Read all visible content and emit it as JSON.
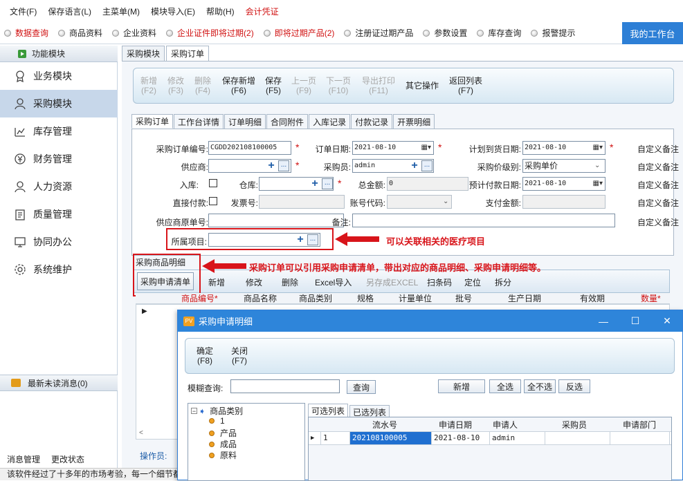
{
  "menu": [
    "文件(F)",
    "保存语言(L)",
    "主菜单(M)",
    "模块导入(E)",
    "帮助(H)",
    "会计凭证"
  ],
  "quickbar": {
    "items": [
      {
        "label": "数据查询",
        "red": true
      },
      {
        "label": "商品资料",
        "red": false
      },
      {
        "label": "企业资料",
        "red": false
      },
      {
        "label": "企业证件即将过期(2)",
        "red": true
      },
      {
        "label": "即将过期产品(2)",
        "red": true
      },
      {
        "label": "注册证过期产品",
        "red": false
      },
      {
        "label": "参数设置",
        "red": false
      },
      {
        "label": "库存查询",
        "red": false
      },
      {
        "label": "报警提示",
        "red": false
      }
    ],
    "workbench": "我的工作台"
  },
  "left": {
    "header": "功能模块",
    "modules": [
      "业务模块",
      "采购模块",
      "库存管理",
      "财务管理",
      "人力资源",
      "质量管理",
      "协同办公",
      "系统维护"
    ],
    "selected_index": 1,
    "unread": "最新未读消息(0)",
    "bottom_links": [
      "消息管理",
      "更改状态"
    ]
  },
  "main_tabs": [
    "采购模块",
    "采购订单"
  ],
  "toolbar": [
    {
      "label": "新增",
      "key": "(F2)",
      "enabled": false
    },
    {
      "label": "修改",
      "key": "(F3)",
      "enabled": false
    },
    {
      "label": "删除",
      "key": "(F4)",
      "enabled": false
    },
    {
      "label": "保存新增",
      "key": "(F6)",
      "enabled": true
    },
    {
      "label": "保存",
      "key": "(F5)",
      "enabled": true
    },
    {
      "label": "上一页",
      "key": "(F9)",
      "enabled": false
    },
    {
      "label": "下一页",
      "key": "(F10)",
      "enabled": false
    },
    {
      "label": "导出打印",
      "key": "(F11)",
      "enabled": false
    },
    {
      "label": "其它操作",
      "key": "",
      "enabled": true
    },
    {
      "label": "返回列表",
      "key": "(F7)",
      "enabled": true
    }
  ],
  "form_tabs": [
    "采购订单",
    "工作台详情",
    "订单明细",
    "合同附件",
    "入库记录",
    "付款记录",
    "开票明细"
  ],
  "form": {
    "order_no_label": "采购订单编号:",
    "order_no": "CGDD202108100005",
    "order_date_label": "订单日期:",
    "order_date": "2021-08-10",
    "plan_arrival_label": "计划到货日期:",
    "plan_arrival": "2021-08-10",
    "supplier_label": "供应商:",
    "buyer_label": "采购员:",
    "buyer": "admin",
    "price_level_label": "采购价级别:",
    "price_level": "采购单价",
    "stock_in_label": "入库:",
    "warehouse_label": "仓库:",
    "total_label": "总金额:",
    "total": "0",
    "pay_date_label": "预计付款日期:",
    "pay_date": "2021-08-10",
    "direct_pay_label": "直接付款:",
    "invoice_label": "发票号:",
    "account_label": "账号代码:",
    "pay_amount_label": "支付金额:",
    "supplier_order_label": "供应商原单号:",
    "note_label": "备注:",
    "project_label": "所属项目:",
    "custom_label": "自定义备注"
  },
  "annotations": {
    "project": "可以关联相关的医疗项目",
    "request": "采购订单可以引用采购申请清单，带出对应的商品明细、采购申请明细等。"
  },
  "product_section": {
    "title": "采购商品明细",
    "request_button": "采购申请清单",
    "buttons": [
      {
        "label": "新增",
        "enabled": true
      },
      {
        "label": "修改",
        "enabled": true
      },
      {
        "label": "删除",
        "enabled": true
      },
      {
        "label": "Excel导入",
        "enabled": true
      },
      {
        "label": "另存成EXCEL",
        "enabled": false
      },
      {
        "label": "扫条码",
        "enabled": true
      },
      {
        "label": "定位",
        "enabled": true
      },
      {
        "label": "拆分",
        "enabled": true
      }
    ],
    "columns": [
      "商品编号*",
      "商品名称",
      "商品类别",
      "规格",
      "计量单位",
      "批号",
      "生产日期",
      "有效期",
      "数量*"
    ],
    "operator_label": "操作员:"
  },
  "dialog": {
    "title": "采购申请明细",
    "confirm": "确定",
    "confirm_key": "(F8)",
    "close": "关闭",
    "close_key": "(F7)",
    "search_label": "模糊查询:",
    "search_value": "",
    "query_button": "查询",
    "buttons": [
      "新增",
      "全选",
      "全不选",
      "反选"
    ],
    "tree": {
      "root": "商品类别",
      "children": [
        "1",
        "产品",
        "成品",
        "原料"
      ]
    },
    "list_tabs": [
      "可选列表",
      "已选列表"
    ],
    "list_columns": [
      "流水号",
      "申请日期",
      "申请人",
      "采购员",
      "申请部门"
    ],
    "rows": [
      {
        "index": "1",
        "serial": "202108100005",
        "date": "2021-08-10",
        "applicant": "admin",
        "buyer": "",
        "dept": ""
      }
    ]
  },
  "status_text": "该软件经过了十多年的市场考验，每一个细节都"
}
